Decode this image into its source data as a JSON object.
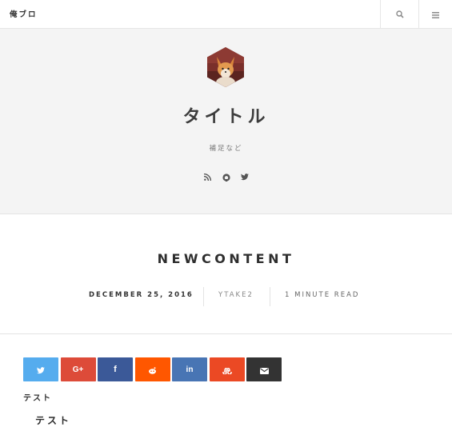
{
  "header": {
    "brand": "俺ブロ",
    "search_icon": "search-icon",
    "menu_icon": "hamburger-menu-icon"
  },
  "hero": {
    "avatar_icon": "fox-avatar",
    "title": "タイトル",
    "subtitle": "補足など",
    "social": [
      "rss-icon",
      "github-icon",
      "twitter-icon"
    ]
  },
  "post": {
    "title": "NEWCONTENT",
    "date": "DECEMBER 25, 2016",
    "author": "YTAKE2",
    "read_time": "1 MINUTE READ"
  },
  "share": [
    {
      "name": "twitter",
      "icon": "twitter-icon",
      "color": "#55acee"
    },
    {
      "name": "google-plus",
      "icon": "google-plus-icon",
      "color": "#dd4b39"
    },
    {
      "name": "facebook",
      "icon": "facebook-icon",
      "color": "#3b5998"
    },
    {
      "name": "reddit",
      "icon": "reddit-icon",
      "color": "#ff5700"
    },
    {
      "name": "linkedin",
      "icon": "linkedin-icon",
      "color": "#4875b4"
    },
    {
      "name": "stumbleupon",
      "icon": "stumbleupon-icon",
      "color": "#eb4924"
    },
    {
      "name": "email",
      "icon": "envelope-icon",
      "color": "#333333"
    }
  ],
  "content": {
    "paragraph": "テスト",
    "heading": "テスト"
  }
}
